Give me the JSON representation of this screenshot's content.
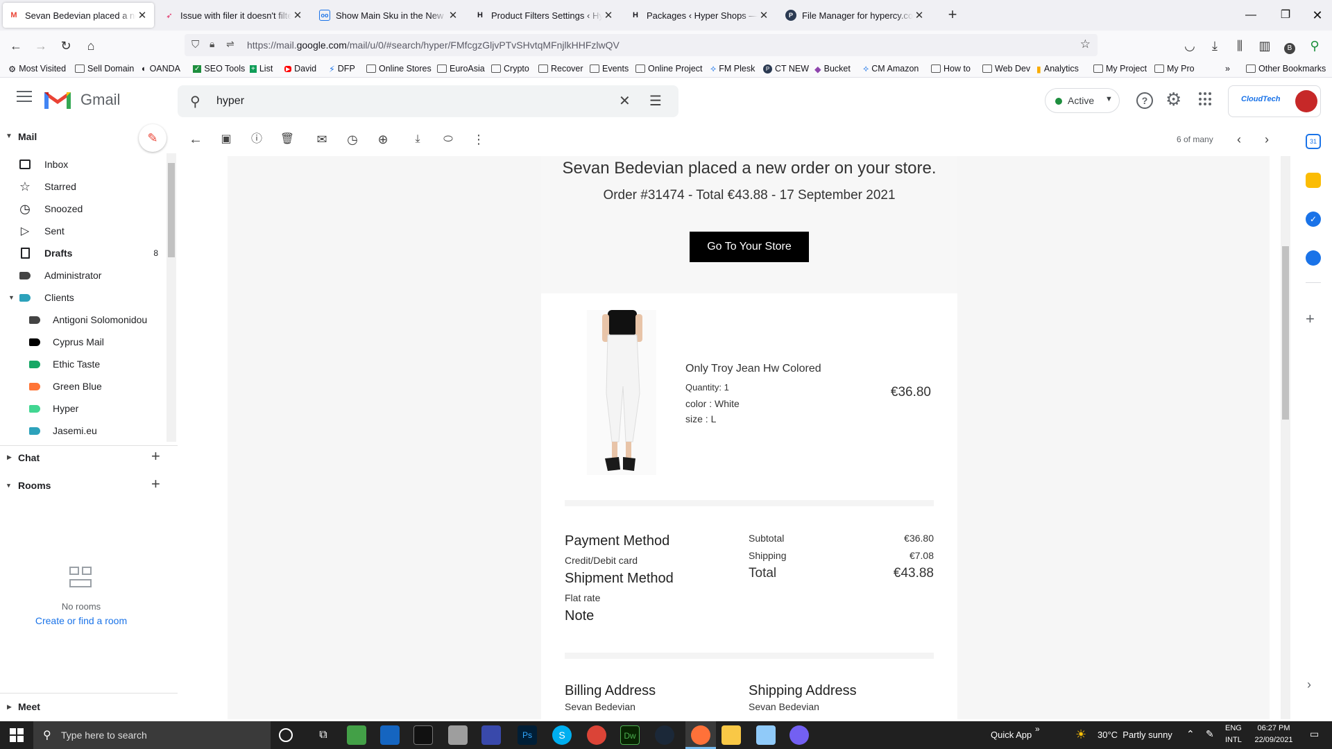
{
  "browser": {
    "tabs": [
      {
        "title": "Sevan Bedevian placed a new order",
        "active": true
      },
      {
        "title": "Issue with filer it doesn't filter on the right"
      },
      {
        "title": "Show Main Sku in the New order email"
      },
      {
        "title": "Product Filters Settings ‹ Hyper"
      },
      {
        "title": "Packages ‹ Hyper Shops — WordPress"
      },
      {
        "title": "File Manager for hypercy.com - Plesk"
      }
    ],
    "url_prefix": "https://mail.",
    "url_domain": "google.com",
    "url_rest": "/mail/u/0/#search/hyper/FMfcgzGljvPTvSHvtqMFnjlkHHFzlwQV",
    "bookmarks": [
      "Most Visited",
      "Sell Domain",
      "OANDA",
      "SEO Tools",
      "List",
      "David",
      "DFP",
      "Online Stores",
      "EuroAsia",
      "Crypto",
      "Recover",
      "Events",
      "Online Project",
      "FM Plesk",
      "CT NEW",
      "Bucket",
      "CM Amazon",
      "How to",
      "Web Dev",
      "Analytics",
      "My Project",
      "My Pro"
    ],
    "other_bookmarks": "Other Bookmarks"
  },
  "gmail": {
    "logo_text": "Gmail",
    "search_query": "hyper",
    "status": "Active",
    "brand_badge": "CloudTech"
  },
  "sidebar": {
    "mail_header": "Mail",
    "items": [
      {
        "label": "Inbox",
        "icon": "inbox-icon"
      },
      {
        "label": "Starred",
        "icon": "star-icon"
      },
      {
        "label": "Snoozed",
        "icon": "clock-icon"
      },
      {
        "label": "Sent",
        "icon": "send-icon"
      },
      {
        "label": "Drafts",
        "icon": "draft-icon",
        "count": "8"
      },
      {
        "label": "Administrator",
        "icon": "label-icon"
      },
      {
        "label": "Clients",
        "icon": "label-icon"
      }
    ],
    "sub_items": [
      {
        "label": "Antigoni Solomonidou",
        "color": "#444444"
      },
      {
        "label": "Cyprus Mail",
        "color": "#000000"
      },
      {
        "label": "Ethic Taste",
        "color": "#16a765"
      },
      {
        "label": "Green Blue",
        "color": "#ff7537"
      },
      {
        "label": "Hyper",
        "color": "#42d692"
      },
      {
        "label": "Jasemi.eu",
        "color": "#2da2bb"
      }
    ],
    "chat": "Chat",
    "rooms": "Rooms",
    "no_rooms": "No rooms",
    "create_room": "Create or find a room",
    "meet": "Meet"
  },
  "toolbar": {
    "pagination": "6 of many"
  },
  "email": {
    "headline": "Sevan Bedevian placed a new order on your store.",
    "subline": "Order #31474 - Total €43.88 - 17 September 2021",
    "store_button": "Go To Your Store",
    "product": {
      "name": "Only Troy Jean Hw Colored",
      "quantity": "Quantity: 1",
      "color_label": "color : ",
      "color_value": "White",
      "size_label": "size : ",
      "size_value": "L",
      "price": "€36.80"
    },
    "payment_method_title": "Payment Method",
    "payment_method": "Credit/Debit card",
    "shipment_method_title": "Shipment Method",
    "shipment_method": "Flat rate",
    "note_title": "Note",
    "subtotal_label": "Subtotal",
    "subtotal": "€36.80",
    "shipping_label": "Shipping",
    "shipping": "€7.08",
    "total_label": "Total",
    "total": "€43.88",
    "billing_title": "Billing Address",
    "billing_name": "Sevan Bedevian",
    "shipping_title": "Shipping Address",
    "shipping_name": "Sevan Bedevian"
  },
  "taskbar": {
    "search_placeholder": "Type here to search",
    "quick_app": "Quick App",
    "weather": "30°C  Partly sunny",
    "lang1": "ENG",
    "lang2": "INTL",
    "time": "06:27 PM",
    "date": "22/09/2021"
  },
  "colors": {
    "gmail_red": "#ea4335",
    "active_green": "#1e8e3e",
    "taskbar": "#202020"
  }
}
